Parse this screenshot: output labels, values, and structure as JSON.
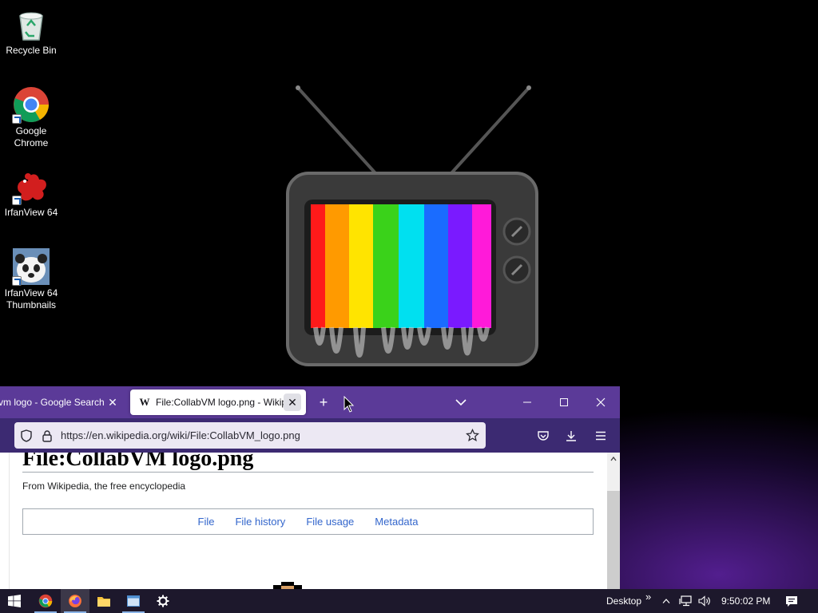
{
  "desktop": {
    "icons": [
      {
        "label": "Recycle Bin",
        "icon": "recycle-bin-icon"
      },
      {
        "label": "Google Chrome",
        "icon": "chrome-icon"
      },
      {
        "label": "IrfanView 64",
        "icon": "irfanview-icon"
      },
      {
        "label": "IrfanView 64 Thumbnails",
        "icon": "irfanview-thumbnails-icon"
      }
    ]
  },
  "browser": {
    "tabs": [
      {
        "title": "vm logo - Google Search",
        "close": "✕",
        "active": false
      },
      {
        "title": "File:CollabVM logo.png - Wikipedia",
        "favicon": "W",
        "close": "✕",
        "active": true
      }
    ],
    "new_tab": "+",
    "url": "https://en.wikipedia.org/wiki/File:CollabVM_logo.png"
  },
  "page": {
    "title": "File:CollabVM logo.png",
    "tagline": "From Wikipedia, the free encyclopedia",
    "file_nav": [
      "File",
      "File history",
      "File usage",
      "Metadata"
    ]
  },
  "taskbar": {
    "pinned": [
      "windows-start-icon",
      "chrome-icon",
      "firefox-icon",
      "file-explorer-icon",
      "window-app-icon",
      "settings-gear-icon"
    ],
    "desktop_label": "Desktop",
    "desktop_chevron": "»",
    "clock": "9:50:02 PM"
  },
  "colors": {
    "tabbar": "#5b3a98",
    "toolbar": "#3c2a72",
    "link": "#3366cc"
  }
}
